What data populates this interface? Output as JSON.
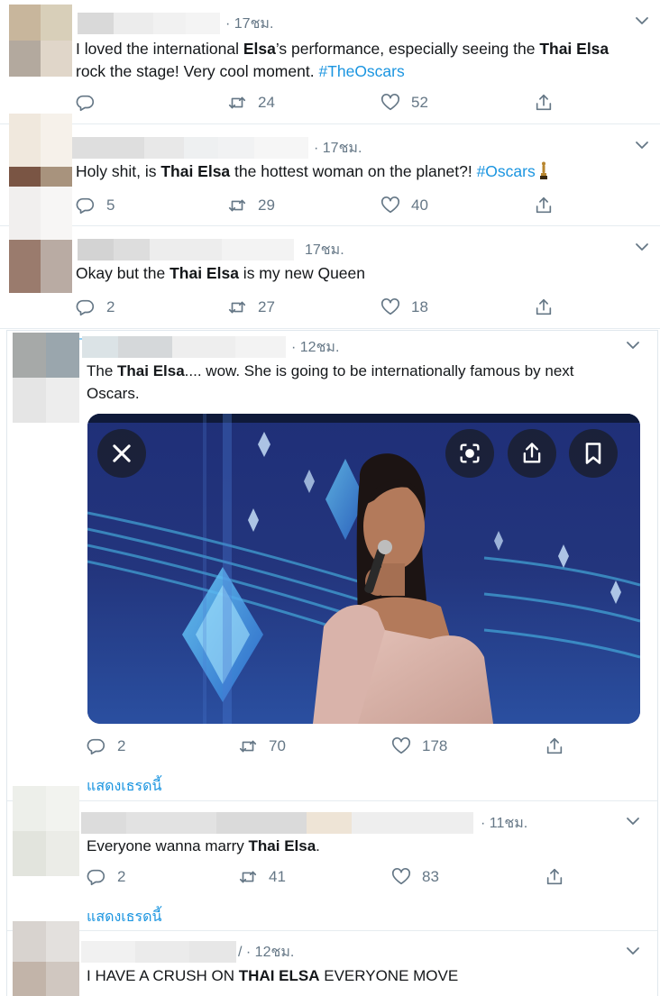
{
  "tweets": [
    {
      "time": "· 17ชม.",
      "parts": [
        {
          "t": "I loved the international "
        },
        {
          "t": "Elsa",
          "b": true
        },
        {
          "t": "’s performance, especially seeing the "
        },
        {
          "t": "Thai Elsa",
          "b": true
        },
        {
          "t": "\n rock the stage! Very cool moment. "
        },
        {
          "t": "#TheOscars",
          "h": true
        }
      ],
      "reply": "",
      "retweet": "24",
      "like": "52"
    },
    {
      "time": "· 17ชม.",
      "parts": [
        {
          "t": "Holy shit, is "
        },
        {
          "t": "Thai Elsa",
          "b": true
        },
        {
          "t": " the hottest woman on the planet?! "
        },
        {
          "t": "#Oscars",
          "h": true
        }
      ],
      "reply": "5",
      "retweet": "29",
      "like": "40"
    },
    {
      "time": "17ชม.",
      "parts": [
        {
          "t": "Okay but the "
        },
        {
          "t": "Thai Elsa",
          "b": true
        },
        {
          "t": " is my new Queen"
        }
      ],
      "reply": "2",
      "retweet": "27",
      "like": "18"
    },
    {
      "time": "· 12ชม.",
      "parts": [
        {
          "t": "The "
        },
        {
          "t": "Thai Elsa",
          "b": true
        },
        {
          "t": ".... wow. She is going to be internationally famous by next\nOscars."
        }
      ],
      "reply": "2",
      "retweet": "70",
      "like": "178",
      "show_thread": "แสดงเธรดนี้"
    },
    {
      "time": "· 11ชม.",
      "parts": [
        {
          "t": "Everyone wanna marry "
        },
        {
          "t": "Thai Elsa",
          "b": true
        },
        {
          "t": "."
        }
      ],
      "reply": "2",
      "retweet": "41",
      "like": "83",
      "show_thread": "แสดงเธรดนี้"
    },
    {
      "time": "/ · 12ชม.",
      "parts": [
        {
          "t": "I HAVE A CRUSH ON "
        },
        {
          "t": "THAI ELSA",
          "b": true
        },
        {
          "t": " EVERYONE MOVE"
        }
      ]
    }
  ],
  "icons": {
    "caret": "chevron-down-icon",
    "reply": "reply-icon",
    "retweet": "retweet-icon",
    "like": "heart-icon",
    "share": "share-icon",
    "media_close": "close-icon",
    "media_lens": "lens-icon",
    "media_share": "share-icon",
    "media_bookmark": "bookmark-icon"
  },
  "colors": {
    "hashtag": "#1b95e0",
    "muted": "#657786",
    "text": "#14171a",
    "divider": "#e6ecf0"
  }
}
